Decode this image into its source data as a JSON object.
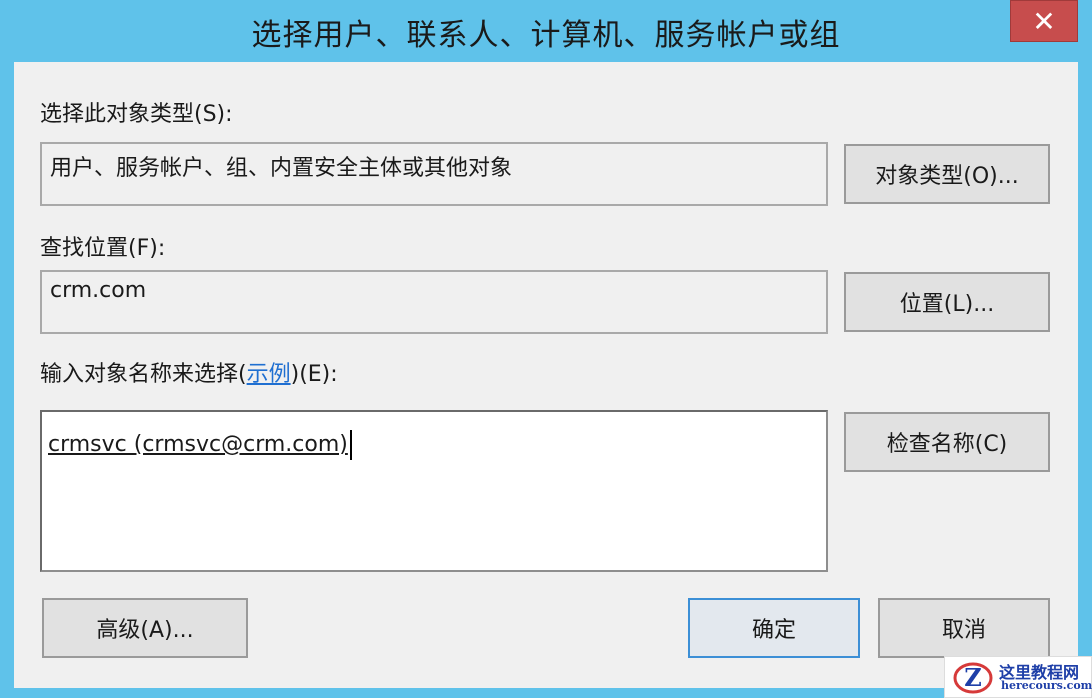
{
  "window": {
    "title": "选择用户、联系人、计算机、服务帐户或组",
    "close_glyph": "✕"
  },
  "object_type": {
    "label": "选择此对象类型(S):",
    "value": "用户、服务帐户、组、内置安全主体或其他对象",
    "button": "对象类型(O)..."
  },
  "location": {
    "label": "查找位置(F):",
    "value": "crm.com",
    "button": "位置(L)..."
  },
  "names": {
    "label_prefix": "输入对象名称来选择(",
    "label_link": "示例",
    "label_suffix": ")(E):",
    "value": "crmsvc (crmsvc@crm.com)",
    "check_button": "检查名称(C)"
  },
  "footer": {
    "advanced_button": "高级(A)...",
    "ok_button": "确定",
    "cancel_button": "取消"
  },
  "watermark": {
    "name": "这里教程网",
    "url": "herecours.com",
    "logo_letter": "Z"
  },
  "colors": {
    "titlebar": "#5fc2ea",
    "close": "#c74d4d",
    "link": "#1f6fd1",
    "primary_border": "#3c8fd6"
  }
}
